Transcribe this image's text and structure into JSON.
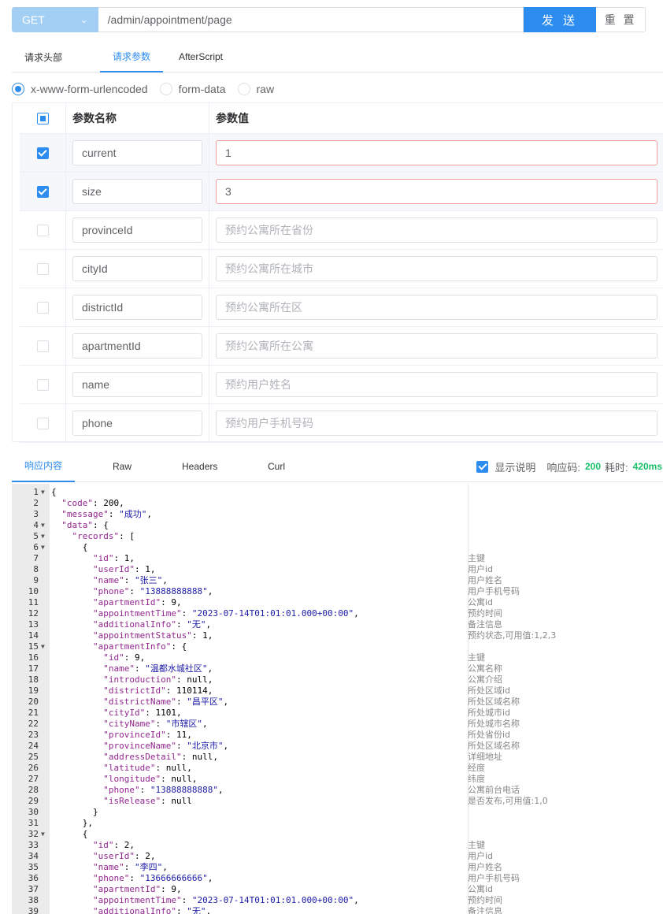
{
  "request": {
    "method": "GET",
    "url": "/admin/appointment/page",
    "send_label": "发 送",
    "reset_label": "重 置"
  },
  "request_tabs": [
    "请求头部",
    "请求参数",
    "AfterScript"
  ],
  "body_types": [
    "x-www-form-urlencoded",
    "form-data",
    "raw"
  ],
  "params": {
    "header_name": "参数名称",
    "header_value": "参数值",
    "rows": [
      {
        "checked": true,
        "name": "current",
        "value": "1",
        "placeholder": ""
      },
      {
        "checked": true,
        "name": "size",
        "value": "3",
        "placeholder": ""
      },
      {
        "checked": false,
        "name": "provinceId",
        "value": "",
        "placeholder": "预约公寓所在省份"
      },
      {
        "checked": false,
        "name": "cityId",
        "value": "",
        "placeholder": "预约公寓所在城市"
      },
      {
        "checked": false,
        "name": "districtId",
        "value": "",
        "placeholder": "预约公寓所在区"
      },
      {
        "checked": false,
        "name": "apartmentId",
        "value": "",
        "placeholder": "预约公寓所在公寓"
      },
      {
        "checked": false,
        "name": "name",
        "value": "",
        "placeholder": "预约用户姓名"
      },
      {
        "checked": false,
        "name": "phone",
        "value": "",
        "placeholder": "预约用户手机号码"
      }
    ]
  },
  "response_tabs": [
    "响应内容",
    "Raw",
    "Headers",
    "Curl"
  ],
  "response_status": {
    "show_desc_label": "显示说明",
    "code_label": "响应码:",
    "code": "200",
    "time_label": "耗时:",
    "time": "420ms"
  },
  "code_lines": [
    {
      "n": "1",
      "f": true,
      "t": "{",
      "c": ""
    },
    {
      "n": "2",
      "f": false,
      "t": "  \"code\": 200,",
      "c": ""
    },
    {
      "n": "3",
      "f": false,
      "t": "  \"message\": \"成功\",",
      "c": ""
    },
    {
      "n": "4",
      "f": true,
      "t": "  \"data\": {",
      "c": ""
    },
    {
      "n": "5",
      "f": true,
      "t": "    \"records\": [",
      "c": ""
    },
    {
      "n": "6",
      "f": true,
      "t": "      {",
      "c": ""
    },
    {
      "n": "7",
      "f": false,
      "t": "        \"id\": 1,",
      "c": "主键"
    },
    {
      "n": "8",
      "f": false,
      "t": "        \"userId\": 1,",
      "c": "用户id"
    },
    {
      "n": "9",
      "f": false,
      "t": "        \"name\": \"张三\",",
      "c": "用户姓名"
    },
    {
      "n": "10",
      "f": false,
      "t": "        \"phone\": \"13888888888\",",
      "c": "用户手机号码"
    },
    {
      "n": "11",
      "f": false,
      "t": "        \"apartmentId\": 9,",
      "c": "公寓id"
    },
    {
      "n": "12",
      "f": false,
      "t": "        \"appointmentTime\": \"2023-07-14T01:01:01.000+00:00\",",
      "c": "预约时间"
    },
    {
      "n": "13",
      "f": false,
      "t": "        \"additionalInfo\": \"无\",",
      "c": "备注信息"
    },
    {
      "n": "14",
      "f": false,
      "t": "        \"appointmentStatus\": 1,",
      "c": "预约状态,可用值:1,2,3"
    },
    {
      "n": "15",
      "f": true,
      "t": "        \"apartmentInfo\": {",
      "c": ""
    },
    {
      "n": "16",
      "f": false,
      "t": "          \"id\": 9,",
      "c": "主键"
    },
    {
      "n": "17",
      "f": false,
      "t": "          \"name\": \"温都水城社区\",",
      "c": "公寓名称"
    },
    {
      "n": "18",
      "f": false,
      "t": "          \"introduction\": null,",
      "c": "公寓介绍"
    },
    {
      "n": "19",
      "f": false,
      "t": "          \"districtId\": 110114,",
      "c": "所处区域id"
    },
    {
      "n": "20",
      "f": false,
      "t": "          \"districtName\": \"昌平区\",",
      "c": "所处区域名称"
    },
    {
      "n": "21",
      "f": false,
      "t": "          \"cityId\": 1101,",
      "c": "所处城市id"
    },
    {
      "n": "22",
      "f": false,
      "t": "          \"cityName\": \"市辖区\",",
      "c": "所处城市名称"
    },
    {
      "n": "23",
      "f": false,
      "t": "          \"provinceId\": 11,",
      "c": "所处省份id"
    },
    {
      "n": "24",
      "f": false,
      "t": "          \"provinceName\": \"北京市\",",
      "c": "所处区域名称"
    },
    {
      "n": "25",
      "f": false,
      "t": "          \"addressDetail\": null,",
      "c": "详细地址"
    },
    {
      "n": "26",
      "f": false,
      "t": "          \"latitude\": null,",
      "c": "经度"
    },
    {
      "n": "27",
      "f": false,
      "t": "          \"longitude\": null,",
      "c": "纬度"
    },
    {
      "n": "28",
      "f": false,
      "t": "          \"phone\": \"13888888888\",",
      "c": "公寓前台电话"
    },
    {
      "n": "29",
      "f": false,
      "t": "          \"isRelease\": null",
      "c": "是否发布,可用值:1,0"
    },
    {
      "n": "30",
      "f": false,
      "t": "        }",
      "c": ""
    },
    {
      "n": "31",
      "f": false,
      "t": "      },",
      "c": ""
    },
    {
      "n": "32",
      "f": true,
      "t": "      {",
      "c": ""
    },
    {
      "n": "33",
      "f": false,
      "t": "        \"id\": 2,",
      "c": "主键"
    },
    {
      "n": "34",
      "f": false,
      "t": "        \"userId\": 2,",
      "c": "用户id"
    },
    {
      "n": "35",
      "f": false,
      "t": "        \"name\": \"李四\",",
      "c": "用户姓名"
    },
    {
      "n": "36",
      "f": false,
      "t": "        \"phone\": \"13666666666\",",
      "c": "用户手机号码"
    },
    {
      "n": "37",
      "f": false,
      "t": "        \"apartmentId\": 9,",
      "c": "公寓id"
    },
    {
      "n": "38",
      "f": false,
      "t": "        \"appointmentTime\": \"2023-07-14T01:01:01.000+00:00\",",
      "c": "预约时间"
    },
    {
      "n": "39",
      "f": false,
      "t": "        \"additionalInfo\": \"无\",",
      "c": "备注信息"
    }
  ]
}
